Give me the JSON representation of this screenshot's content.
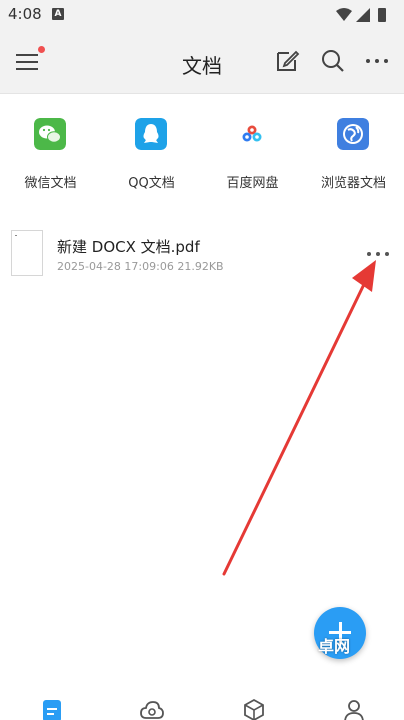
{
  "status_bar": {
    "time": "4:08",
    "notification_letter": "A"
  },
  "header": {
    "title": "文档",
    "icons": [
      "menu-icon",
      "edit-icon",
      "search-icon",
      "more-icon"
    ]
  },
  "sources": [
    {
      "label": "微信文档",
      "icon": "wechat-icon",
      "color": "#4cb848"
    },
    {
      "label": "QQ文档",
      "icon": "qq-icon",
      "color": "#1ea2e8"
    },
    {
      "label": "百度网盘",
      "icon": "baidu-netdisk-icon",
      "color": "#2f7cf0"
    },
    {
      "label": "浏览器文档",
      "icon": "browser-icon",
      "color": "#3f7fe0"
    }
  ],
  "files": [
    {
      "name": "新建 DOCX 文档.pdf",
      "date": "2025-04-28 17:09:06",
      "size": "21.92KB"
    }
  ],
  "fab": {
    "watermark": "卓网"
  },
  "bottom_nav": [
    "documents-icon",
    "cloud-icon",
    "apps-icon",
    "profile-icon"
  ],
  "colors": {
    "accent": "#2a9df4",
    "arrow": "#e53935",
    "badge": "#f05050"
  }
}
